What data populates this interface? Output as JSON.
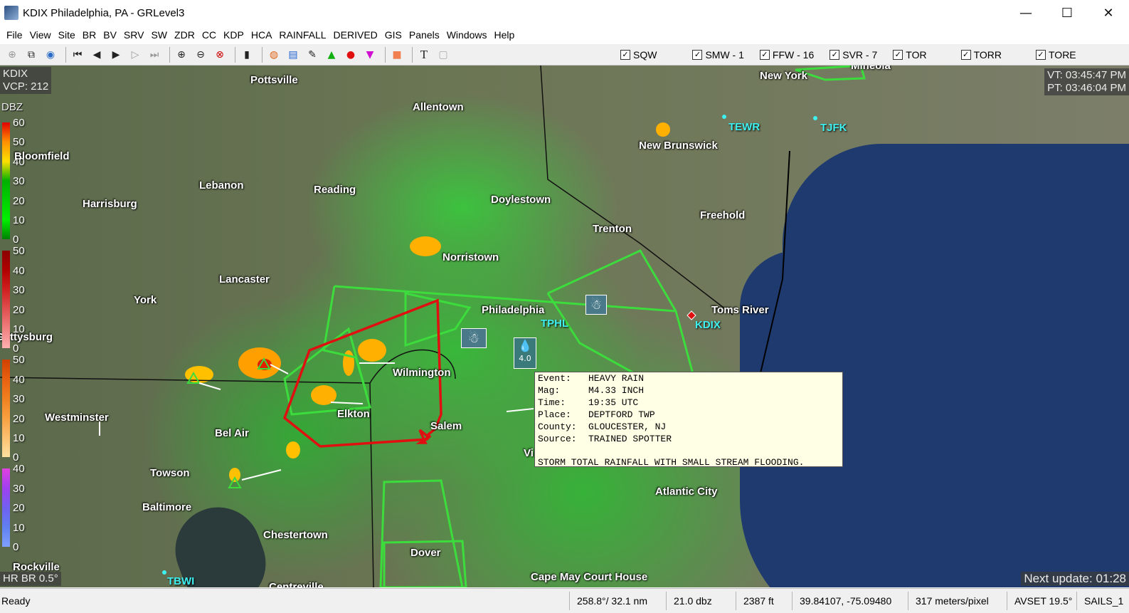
{
  "window": {
    "title": "KDIX Philadelphia, PA - GRLevel3",
    "minimize": "—",
    "maximize": "☐",
    "close": "✕"
  },
  "menu": [
    "File",
    "View",
    "Site",
    "BR",
    "BV",
    "SRV",
    "SW",
    "ZDR",
    "CC",
    "KDP",
    "HCA",
    "RAINFALL",
    "DERIVED",
    "GIS",
    "Panels",
    "Windows",
    "Help"
  ],
  "toolbar": {
    "buttons": [
      {
        "name": "globe-icon",
        "glyph": "⊕"
      },
      {
        "name": "copy-icon",
        "glyph": "⧉"
      },
      {
        "name": "world-icon",
        "glyph": "◉"
      },
      {
        "name": "first-frame-icon",
        "glyph": "⏮"
      },
      {
        "name": "step-back-icon",
        "glyph": "◀"
      },
      {
        "name": "play-icon",
        "glyph": "▶"
      },
      {
        "name": "step-forward-icon",
        "glyph": "▷"
      },
      {
        "name": "last-frame-icon",
        "glyph": "⏭"
      },
      {
        "name": "zoom-in-icon",
        "glyph": "⊕"
      },
      {
        "name": "zoom-out-icon",
        "glyph": "⊖"
      },
      {
        "name": "zoom-reset-icon",
        "glyph": "⊗"
      },
      {
        "name": "layer-icon",
        "glyph": "▮"
      },
      {
        "name": "storm-icon",
        "glyph": "◍"
      },
      {
        "name": "colorbar-icon",
        "glyph": "▤"
      },
      {
        "name": "tool-icon",
        "glyph": "✎"
      },
      {
        "name": "triangle-icon",
        "glyph": "▲"
      },
      {
        "name": "circle-icon",
        "glyph": "●"
      },
      {
        "name": "inverted-triangle-icon",
        "glyph": "▼"
      },
      {
        "name": "square-icon",
        "glyph": "■"
      },
      {
        "name": "text-icon",
        "glyph": "T"
      },
      {
        "name": "frame-icon",
        "glyph": "▢"
      }
    ],
    "checks": [
      {
        "label": "SQW",
        "checked": true
      },
      {
        "label": "SMW - 1",
        "checked": true
      },
      {
        "label": "FFW - 16",
        "checked": true
      },
      {
        "label": "SVR - 7",
        "checked": true
      },
      {
        "label": "TOR",
        "checked": true
      },
      {
        "label": "TORR",
        "checked": true
      },
      {
        "label": "TORE",
        "checked": true
      }
    ]
  },
  "hud": {
    "site": "KDIX",
    "vcp": "VCP: 212",
    "vt": "VT: 03:45:47 PM",
    "pt": "PT: 03:46:04 PM",
    "product": "HR BR 0.5°",
    "next_update": "Next update: 01:28"
  },
  "legend": {
    "title": "DBZ",
    "groups": [
      {
        "labels": [
          "60",
          "50",
          "40",
          "30",
          "20",
          "10",
          "0"
        ],
        "colors": [
          "#e00000",
          "#ff9000",
          "#ffe000",
          "#00b000",
          "#00d000",
          "#00f000",
          "#008000"
        ]
      },
      {
        "labels": [
          "50",
          "40",
          "30",
          "20",
          "10",
          "0"
        ],
        "colors": [
          "#8b0000",
          "#b00000",
          "#d02020",
          "#e05050",
          "#f08080",
          "#ffb0b0"
        ]
      },
      {
        "labels": [
          "50",
          "40",
          "30",
          "20",
          "10",
          "0"
        ],
        "colors": [
          "#d04000",
          "#e86010",
          "#f08020",
          "#f8a040",
          "#fcc070",
          "#ffe0a0"
        ]
      },
      {
        "labels": [
          "40",
          "30",
          "20",
          "10",
          "0"
        ],
        "colors": [
          "#e040e0",
          "#a040f0",
          "#7060f0",
          "#6080f0",
          "#80a0ff"
        ]
      }
    ]
  },
  "cities": [
    {
      "name": "Pottsville"
    },
    {
      "name": "Allentown"
    },
    {
      "name": "New York"
    },
    {
      "name": "Mineola"
    },
    {
      "name": "Bloomfield"
    },
    {
      "name": "Lebanon"
    },
    {
      "name": "Reading"
    },
    {
      "name": "Harrisburg"
    },
    {
      "name": "New Brunswick"
    },
    {
      "name": "Doylestown"
    },
    {
      "name": "Freehold"
    },
    {
      "name": "Trenton"
    },
    {
      "name": "Norristown"
    },
    {
      "name": "Lancaster"
    },
    {
      "name": "York"
    },
    {
      "name": "Philadelphia"
    },
    {
      "name": "Toms River"
    },
    {
      "name": "Gettysburg"
    },
    {
      "name": "Wilmington"
    },
    {
      "name": "Westminster"
    },
    {
      "name": "Elkton"
    },
    {
      "name": "Bel Air"
    },
    {
      "name": "Salem"
    },
    {
      "name": "Towson"
    },
    {
      "name": "Baltimore"
    },
    {
      "name": "Atlantic City"
    },
    {
      "name": "Chestertown"
    },
    {
      "name": "Dover"
    },
    {
      "name": "Rockville"
    },
    {
      "name": "Cape May Court House"
    },
    {
      "name": "Centreville"
    },
    {
      "name": "Vi"
    }
  ],
  "sites": [
    "TEWR",
    "TJFK",
    "TPHL",
    "KDIX",
    "TBWI"
  ],
  "popup": {
    "rows": [
      {
        "key": "Event:",
        "value": "HEAVY RAIN"
      },
      {
        "key": "Mag:",
        "value": "M4.33 INCH"
      },
      {
        "key": "Time:",
        "value": "19:35 UTC"
      },
      {
        "key": "Place:",
        "value": "DEPTFORD TWP"
      },
      {
        "key": "County:",
        "value": "GLOUCESTER, NJ"
      },
      {
        "key": "Source:",
        "value": "TRAINED SPOTTER"
      }
    ],
    "note": "STORM TOTAL RAINFALL WITH SMALL STREAM FLOODING."
  },
  "report_marker_value": "4.0",
  "status": {
    "ready": "Ready",
    "azimuth": "258.8°/ 32.1 nm",
    "dbz": "21.0 dbz",
    "height": "2387 ft",
    "coords": "39.84107, -75.09480",
    "scale": "317 meters/pixel",
    "avset": "AVSET 19.5°",
    "sails": "SAILS_1"
  },
  "colors": {
    "warning_red": "#e01010",
    "warning_green": "#3ddc3d",
    "site_label": "#3ff0f0",
    "ocean": "#1e3a6e"
  }
}
